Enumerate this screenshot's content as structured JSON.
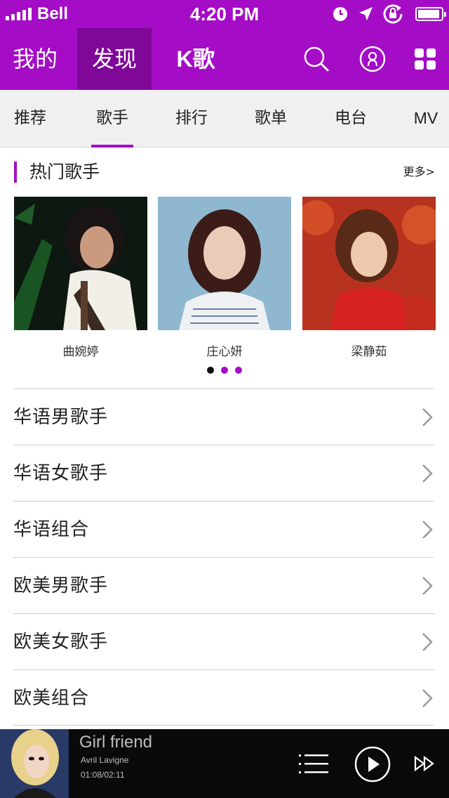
{
  "status_bar": {
    "carrier": "Bell",
    "time": "4:20 PM",
    "signal_bars": 5,
    "battery_level": 0.95,
    "icons": [
      "clock-icon",
      "location-arrow-icon",
      "rotation-lock-icon",
      "battery-icon"
    ]
  },
  "header": {
    "tabs": [
      {
        "label": "我的",
        "active": false
      },
      {
        "label": "发现",
        "active": true
      },
      {
        "label": "K歌",
        "active": false
      }
    ],
    "icons": [
      "search-icon",
      "profile-icon",
      "grid-menu-icon"
    ]
  },
  "subtabs": [
    {
      "label": "推荐",
      "active": false
    },
    {
      "label": "歌手",
      "active": true
    },
    {
      "label": "排行",
      "active": false
    },
    {
      "label": "歌单",
      "active": false
    },
    {
      "label": "电台",
      "active": false
    },
    {
      "label": "MV",
      "active": false
    }
  ],
  "hot_section": {
    "title": "热门歌手",
    "more": "更多>",
    "artists": [
      {
        "name": "曲婉婷"
      },
      {
        "name": "庄心妍"
      },
      {
        "name": "梁静茹"
      }
    ],
    "page_count": 3,
    "current_page": 1
  },
  "categories": [
    {
      "label": "华语男歌手"
    },
    {
      "label": "华语女歌手"
    },
    {
      "label": "华语组合"
    },
    {
      "label": "欧美男歌手"
    },
    {
      "label": "欧美女歌手"
    },
    {
      "label": "欧美组合"
    }
  ],
  "player": {
    "song": "Girl friend",
    "artist": "Avril Lavigne",
    "progress": "01:08/02:11",
    "icons": [
      "playlist-icon",
      "play-icon",
      "next-icon"
    ]
  },
  "colors": {
    "accent": "#a40cc6",
    "accent_dark": "#7f0899",
    "player_bg": "#0a0a0a"
  }
}
